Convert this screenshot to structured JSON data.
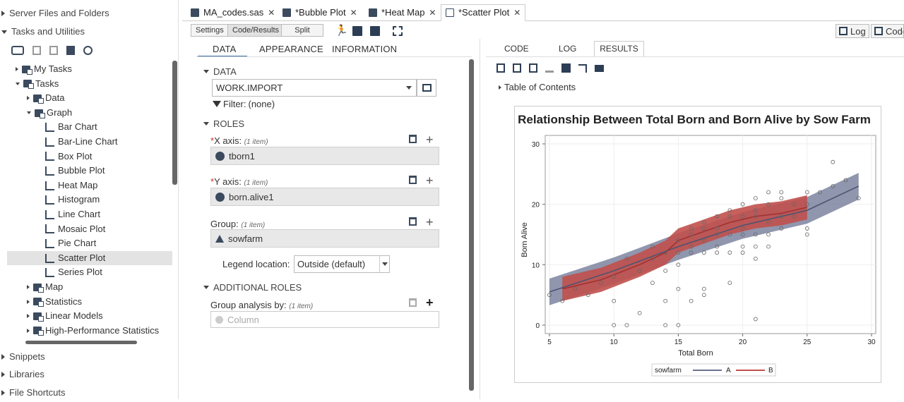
{
  "left_nav": {
    "server_files": "Server Files and Folders",
    "tasks_utilities": "Tasks and Utilities",
    "tree": [
      {
        "label": "My Tasks",
        "indent": 16,
        "state": "collapsed"
      },
      {
        "label": "Tasks",
        "indent": 16,
        "state": "expanded"
      },
      {
        "label": "Data",
        "indent": 32,
        "state": "collapsed"
      },
      {
        "label": "Graph",
        "indent": 32,
        "state": "expanded"
      },
      {
        "label": "Bar Chart",
        "indent": 58,
        "state": "leaf"
      },
      {
        "label": "Bar-Line Chart",
        "indent": 58,
        "state": "leaf"
      },
      {
        "label": "Box Plot",
        "indent": 58,
        "state": "leaf"
      },
      {
        "label": "Bubble Plot",
        "indent": 58,
        "state": "leaf"
      },
      {
        "label": "Heat Map",
        "indent": 58,
        "state": "leaf"
      },
      {
        "label": "Histogram",
        "indent": 58,
        "state": "leaf"
      },
      {
        "label": "Line Chart",
        "indent": 58,
        "state": "leaf"
      },
      {
        "label": "Mosaic Plot",
        "indent": 58,
        "state": "leaf"
      },
      {
        "label": "Pie Chart",
        "indent": 58,
        "state": "leaf"
      },
      {
        "label": "Scatter Plot",
        "indent": 58,
        "state": "selected"
      },
      {
        "label": "Series Plot",
        "indent": 58,
        "state": "leaf"
      },
      {
        "label": "Map",
        "indent": 32,
        "state": "collapsed"
      },
      {
        "label": "Statistics",
        "indent": 32,
        "state": "collapsed"
      },
      {
        "label": "Linear Models",
        "indent": 32,
        "state": "collapsed"
      },
      {
        "label": "High-Performance Statistics",
        "indent": 32,
        "state": "collapsed"
      }
    ],
    "snippets": "Snippets",
    "libraries": "Libraries",
    "file_shortcuts": "File Shortcuts"
  },
  "tabs": [
    {
      "label": "MA_codes.sas"
    },
    {
      "label": "*Bubble Plot"
    },
    {
      "label": "*Heat Map"
    },
    {
      "label": "*Scatter Plot"
    }
  ],
  "toolbar": {
    "settings": "Settings",
    "code_results": "Code/Results",
    "split": "Split",
    "log": "Log",
    "code": "Code"
  },
  "settings": {
    "tabs": {
      "data": "DATA",
      "appearance": "APPEARANCE",
      "information": "INFORMATION"
    },
    "data_section": "DATA",
    "dataset": "WORK.IMPORT",
    "filter_label": "Filter:",
    "filter_value": "(none)",
    "roles_section": "ROLES",
    "x_label": "X axis:",
    "x_count": "(1 item)",
    "x_value": "tborn1",
    "y_label": "Y axis:",
    "y_count": "(1 item)",
    "y_value": "born.alive1",
    "group_label": "Group:",
    "group_count": "(1 item)",
    "group_value": "sowfarm",
    "legend_label": "Legend location:",
    "legend_value": "Outside (default)",
    "additional_section": "ADDITIONAL ROLES",
    "groupby_label": "Group analysis by:",
    "groupby_count": "(1 item)",
    "groupby_placeholder": "Column"
  },
  "results": {
    "tabs": {
      "code": "CODE",
      "log": "LOG",
      "results": "RESULTS"
    },
    "toc": "Table of Contents"
  },
  "chart_data": {
    "type": "scatter",
    "title": "Relationship Between Total Born and Born Alive by Sow Farm",
    "xlabel": "Total Born",
    "ylabel": "Born Alive",
    "xlim": [
      5,
      30
    ],
    "ylim": [
      0,
      30
    ],
    "xticks": [
      5,
      10,
      15,
      20,
      25,
      30
    ],
    "yticks": [
      0,
      10,
      20,
      30
    ],
    "legend_title": "sowfarm",
    "series": [
      {
        "name": "A",
        "color": "#6b7391"
      },
      {
        "name": "B",
        "color": "#c0504d"
      }
    ],
    "points": [
      [
        5,
        5
      ],
      [
        6,
        4
      ],
      [
        7,
        6
      ],
      [
        8,
        5
      ],
      [
        9,
        7
      ],
      [
        10,
        8
      ],
      [
        10,
        4
      ],
      [
        10,
        0
      ],
      [
        11,
        0
      ],
      [
        11,
        11
      ],
      [
        12,
        2
      ],
      [
        12,
        9
      ],
      [
        13,
        13
      ],
      [
        13,
        11
      ],
      [
        13,
        7
      ],
      [
        14,
        12
      ],
      [
        14,
        9
      ],
      [
        14,
        4
      ],
      [
        14,
        0
      ],
      [
        15,
        14
      ],
      [
        15,
        12
      ],
      [
        15,
        10
      ],
      [
        15,
        0
      ],
      [
        15,
        6
      ],
      [
        16,
        16
      ],
      [
        16,
        15
      ],
      [
        16,
        13
      ],
      [
        16,
        4
      ],
      [
        16,
        12
      ],
      [
        17,
        17
      ],
      [
        17,
        16
      ],
      [
        17,
        14
      ],
      [
        17,
        12
      ],
      [
        17,
        6
      ],
      [
        17,
        5
      ],
      [
        18,
        18
      ],
      [
        18,
        16
      ],
      [
        18,
        15
      ],
      [
        18,
        13
      ],
      [
        18,
        12
      ],
      [
        19,
        19
      ],
      [
        19,
        18
      ],
      [
        19,
        15
      ],
      [
        19,
        12
      ],
      [
        19,
        7
      ],
      [
        20,
        20
      ],
      [
        20,
        18
      ],
      [
        20,
        16
      ],
      [
        20,
        15
      ],
      [
        20,
        13
      ],
      [
        20,
        12
      ],
      [
        21,
        21
      ],
      [
        21,
        19
      ],
      [
        21,
        18
      ],
      [
        21,
        15
      ],
      [
        21,
        13
      ],
      [
        21,
        11
      ],
      [
        21,
        1
      ],
      [
        22,
        22
      ],
      [
        22,
        20
      ],
      [
        22,
        17
      ],
      [
        22,
        15
      ],
      [
        22,
        13
      ],
      [
        23,
        22
      ],
      [
        23,
        21
      ],
      [
        23,
        18
      ],
      [
        23,
        16
      ],
      [
        24,
        20
      ],
      [
        24,
        18
      ],
      [
        25,
        22
      ],
      [
        25,
        20
      ],
      [
        25,
        16
      ],
      [
        25,
        15
      ],
      [
        26,
        22
      ],
      [
        27,
        27
      ],
      [
        27,
        23
      ],
      [
        28,
        24
      ],
      [
        29,
        21
      ]
    ],
    "fit_A": [
      [
        5,
        5.5
      ],
      [
        10,
        9
      ],
      [
        15,
        13
      ],
      [
        20,
        16.5
      ],
      [
        25,
        19
      ],
      [
        29,
        23
      ]
    ],
    "fit_B": [
      [
        6,
        6
      ],
      [
        9,
        7.5
      ],
      [
        12,
        10
      ],
      [
        14,
        12
      ],
      [
        15,
        14
      ],
      [
        17,
        15.5
      ],
      [
        19,
        17
      ],
      [
        21,
        18
      ],
      [
        23,
        18.5
      ],
      [
        25,
        19.5
      ]
    ]
  }
}
